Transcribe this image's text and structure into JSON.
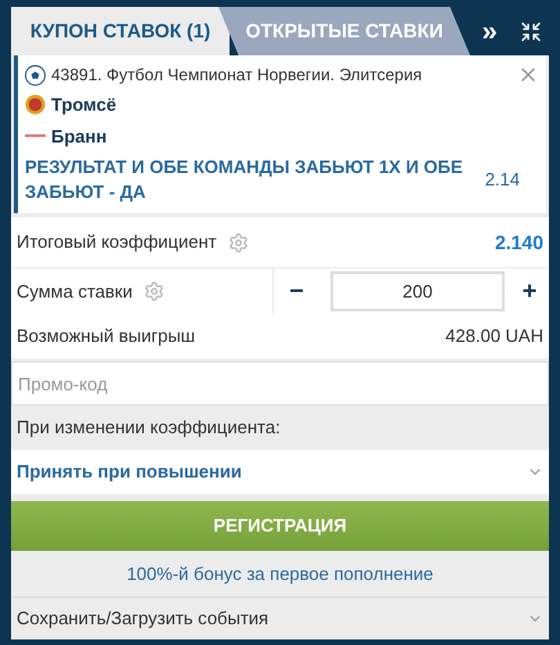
{
  "tabs": [
    {
      "label": "КУПОН СТАВОК (1)",
      "selected": true
    },
    {
      "label": "ОТКРЫТЫЕ СТАВКИ",
      "selected": false
    }
  ],
  "more": "»",
  "bet": {
    "event": "43891. Футбол Чемпионат Норвегии. Элитсерия",
    "teams": [
      "Тромсё",
      "Бранн"
    ],
    "market": "РЕЗУЛЬТАТ И ОБЕ КОМАНДЫ ЗАБЬЮТ 1X И ОБЕ ЗАБЬЮТ - ДА",
    "odds": "2.14"
  },
  "total": {
    "label": "Итоговый коэффициент",
    "value": "2.140"
  },
  "stake": {
    "label": "Сумма ставки",
    "minus": "−",
    "value": "200",
    "plus": "+"
  },
  "winnings": {
    "label": "Возможный выигрыш",
    "value": "428.00 UAH"
  },
  "promo": {
    "placeholder": "Промо-код"
  },
  "odds_change": {
    "label": "При изменении коэффициента:",
    "value": "Принять при повышении"
  },
  "register_button": "РЕГИСТРАЦИЯ",
  "bonus_link": "100%-й бонус за первое пополнение",
  "save_load": "Сохранить/Загрузить события"
}
